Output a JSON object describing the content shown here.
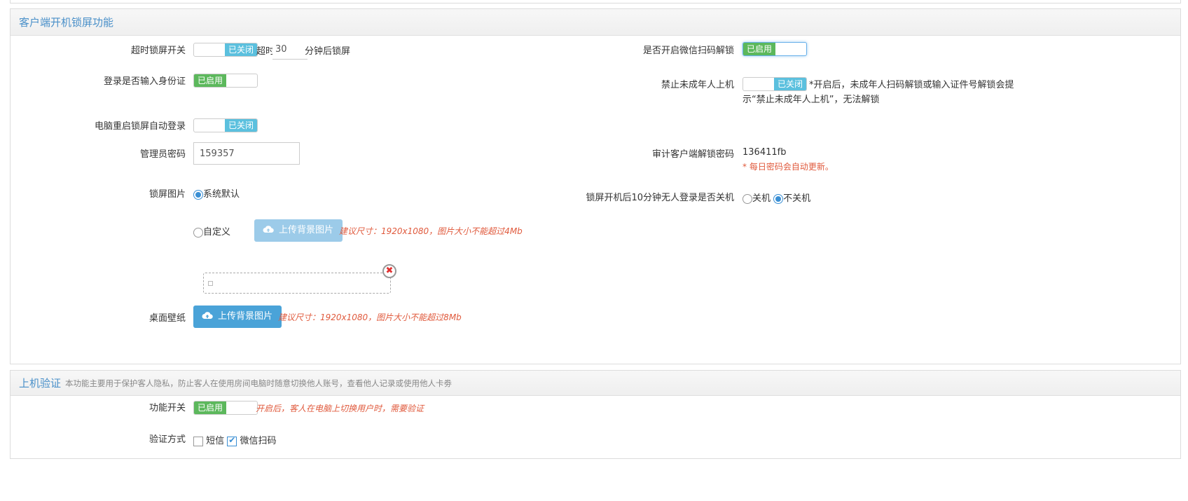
{
  "lock_section": {
    "title": "客户端开机锁屏功能",
    "timeout_lock": {
      "label": "超时锁屏开关",
      "toggle_off": "已关闭",
      "prefix": "超时",
      "minutes": "30",
      "suffix": "分钟后锁屏"
    },
    "wechat_unlock": {
      "label": "是否开启微信扫码解锁",
      "toggle_on": "已启用"
    },
    "login_id": {
      "label": "登录是否输入身份证",
      "toggle_on": "已启用"
    },
    "minor_ban": {
      "label": "禁止未成年人上机",
      "toggle_off": "已关闭",
      "note_line1": "*开启后，未成年人扫码解锁或输入证件号解锁会提",
      "note_line2": "示“禁止未成年人上机”，无法解锁"
    },
    "auto_login": {
      "label": "电脑重启锁屏自动登录",
      "toggle_off": "已关闭"
    },
    "admin_password": {
      "label": "管理员密码",
      "value": "159357"
    },
    "audit_password": {
      "label": "审计客户端解锁密码",
      "value": "136411fb",
      "note": "* 每日密码会自动更新。"
    },
    "lock_image": {
      "label": "锁屏图片",
      "option_default": "系统默认",
      "option_custom": "自定义",
      "upload_label": "上传背景图片",
      "hint": "建议尺寸：1920x1080，图片大小不能超过4Mb"
    },
    "auto_shutdown": {
      "label": "锁屏开机后10分钟无人登录是否关机",
      "option_off": "关机",
      "option_on": "不关机"
    },
    "wallpaper": {
      "label": "桌面壁纸",
      "upload_label": "上传背景图片",
      "hint": "建议尺寸：1920x1080，图片大小不能超过8Mb"
    }
  },
  "verify_section": {
    "title": "上机验证",
    "description": "本功能主要用于保护客人隐私，防止客人在使用房间电脑时随意切换他人账号，查看他人记录或使用他人卡劵",
    "feature_switch": {
      "label": "功能开关",
      "toggle_on": "已启用",
      "hint": "开启后，客人在电脑上切换用户时，需要验证"
    },
    "method": {
      "label": "验证方式",
      "option_sms": "短信",
      "option_wechat": "微信扫码"
    }
  },
  "colors": {
    "enabled": "#5cb85c",
    "disabled": "#5bc0de",
    "title": "#4a90c9",
    "hint": "#e05a3d",
    "upload": "#4aa3d8"
  }
}
